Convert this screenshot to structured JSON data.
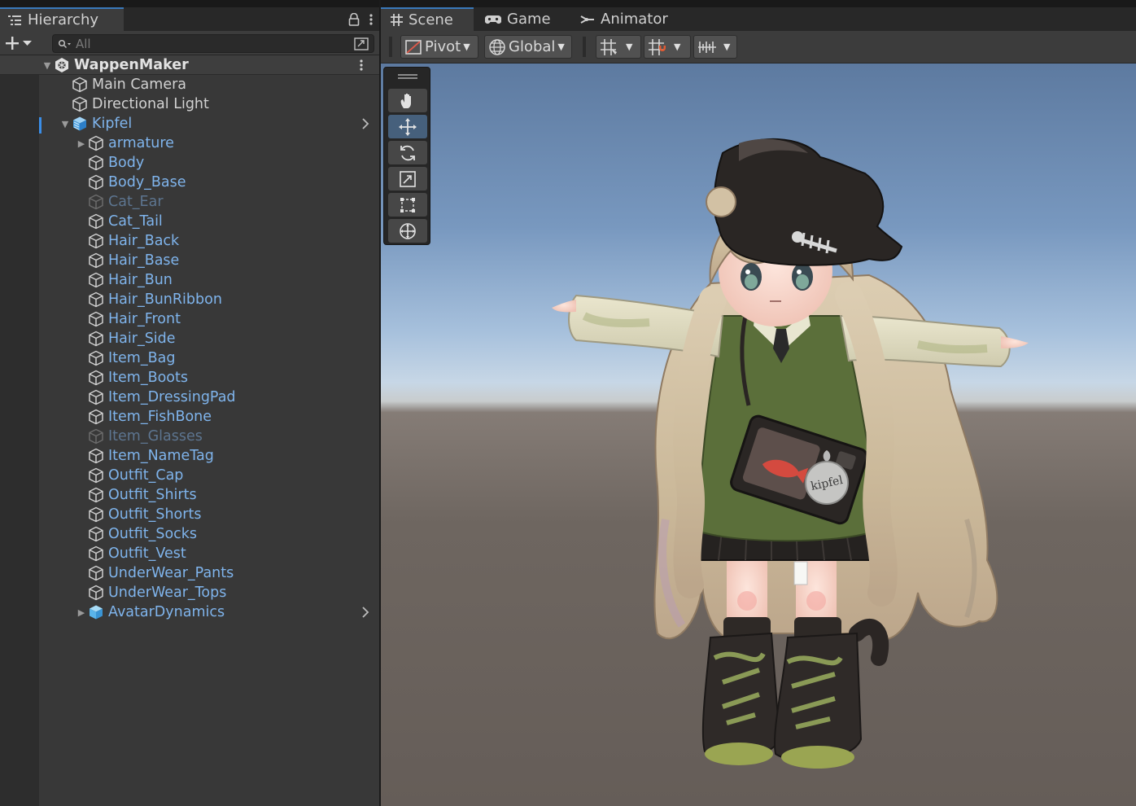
{
  "hierarchy": {
    "tab_label": "Hierarchy",
    "search_placeholder": "All",
    "scene_name": "WappenMaker",
    "items": [
      {
        "label": "Main Camera",
        "state": "normal",
        "depth": 1,
        "expand": "none"
      },
      {
        "label": "Directional Light",
        "state": "normal",
        "depth": 1,
        "expand": "none"
      },
      {
        "label": "Kipfel",
        "state": "prefab",
        "depth": 1,
        "expand": "open",
        "icon": "prefab",
        "chevron": true,
        "selected": true
      },
      {
        "label": "armature",
        "state": "prefab",
        "depth": 2,
        "expand": "closed"
      },
      {
        "label": "Body",
        "state": "prefab",
        "depth": 2,
        "expand": "none"
      },
      {
        "label": "Body_Base",
        "state": "prefab",
        "depth": 2,
        "expand": "none"
      },
      {
        "label": "Cat_Ear",
        "state": "disabled",
        "depth": 2,
        "expand": "none"
      },
      {
        "label": "Cat_Tail",
        "state": "prefab",
        "depth": 2,
        "expand": "none"
      },
      {
        "label": "Hair_Back",
        "state": "prefab",
        "depth": 2,
        "expand": "none"
      },
      {
        "label": "Hair_Base",
        "state": "prefab",
        "depth": 2,
        "expand": "none"
      },
      {
        "label": "Hair_Bun",
        "state": "prefab",
        "depth": 2,
        "expand": "none"
      },
      {
        "label": "Hair_BunRibbon",
        "state": "prefab",
        "depth": 2,
        "expand": "none"
      },
      {
        "label": "Hair_Front",
        "state": "prefab",
        "depth": 2,
        "expand": "none"
      },
      {
        "label": "Hair_Side",
        "state": "prefab",
        "depth": 2,
        "expand": "none"
      },
      {
        "label": "Item_Bag",
        "state": "prefab",
        "depth": 2,
        "expand": "none"
      },
      {
        "label": "Item_Boots",
        "state": "prefab",
        "depth": 2,
        "expand": "none"
      },
      {
        "label": "Item_DressingPad",
        "state": "prefab",
        "depth": 2,
        "expand": "none"
      },
      {
        "label": "Item_FishBone",
        "state": "prefab",
        "depth": 2,
        "expand": "none"
      },
      {
        "label": "Item_Glasses",
        "state": "disabled",
        "depth": 2,
        "expand": "none"
      },
      {
        "label": "Item_NameTag",
        "state": "prefab",
        "depth": 2,
        "expand": "none"
      },
      {
        "label": "Outfit_Cap",
        "state": "prefab",
        "depth": 2,
        "expand": "none"
      },
      {
        "label": "Outfit_Shirts",
        "state": "prefab",
        "depth": 2,
        "expand": "none"
      },
      {
        "label": "Outfit_Shorts",
        "state": "prefab",
        "depth": 2,
        "expand": "none"
      },
      {
        "label": "Outfit_Socks",
        "state": "prefab",
        "depth": 2,
        "expand": "none"
      },
      {
        "label": "Outfit_Vest",
        "state": "prefab",
        "depth": 2,
        "expand": "none"
      },
      {
        "label": "UnderWear_Pants",
        "state": "prefab",
        "depth": 2,
        "expand": "none"
      },
      {
        "label": "UnderWear_Tops",
        "state": "prefab",
        "depth": 2,
        "expand": "none"
      },
      {
        "label": "AvatarDynamics",
        "state": "prefab",
        "depth": 2,
        "expand": "closed",
        "icon": "prefab-solid",
        "chevron": true
      }
    ]
  },
  "scene_view": {
    "tabs": [
      {
        "label": "Scene",
        "icon": "grid-icon",
        "active": true
      },
      {
        "label": "Game",
        "icon": "gamepad-icon",
        "active": false
      },
      {
        "label": "Animator",
        "icon": "animator-icon",
        "active": false
      }
    ],
    "pivot_label": "Pivot",
    "global_label": "Global",
    "name_tag_text": "kipfel"
  },
  "colors": {
    "accent": "#3a79bb",
    "prefab_text": "#7fb4ec",
    "disabled_text": "#5d7590"
  }
}
